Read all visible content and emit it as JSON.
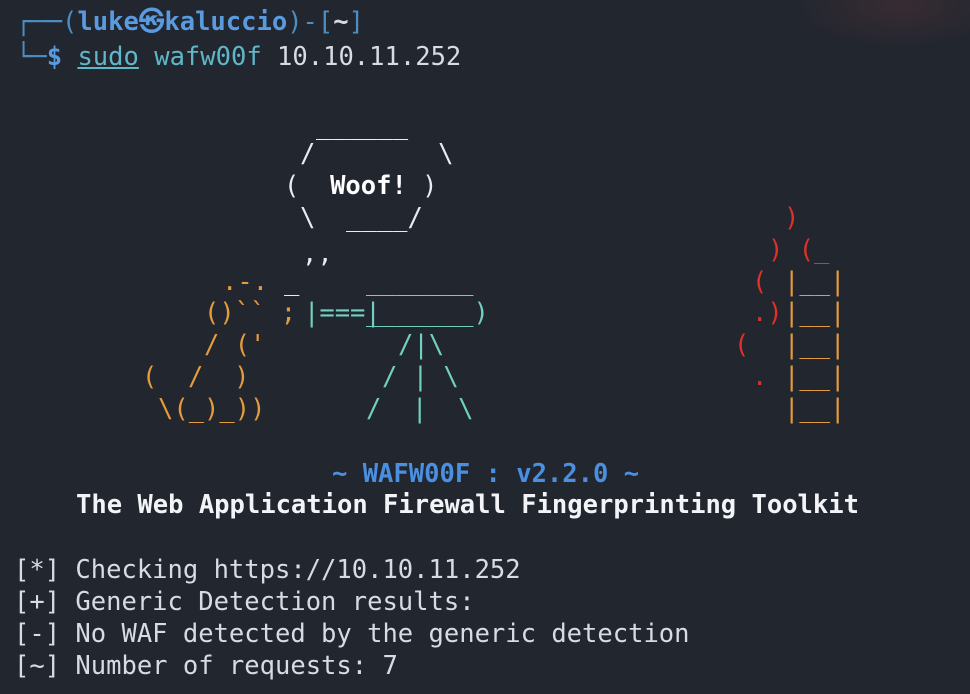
{
  "prompt": {
    "frame_top": "┌──(",
    "user": "luke",
    "at_symbol": "㉿",
    "host": "kaluccio",
    "frame_mid": ")-[",
    "cwd": "~",
    "frame_end": "]",
    "frame_bottom": "└─",
    "dollar": "$",
    "cmd_sudo": "sudo",
    "cmd_main": "wafw00f",
    "cmd_arg": "10.10.11.252"
  },
  "ascii_art": {
    "bubble_top": "______",
    "bubble_l2": "/        \\",
    "bubble_l3_open": "(  ",
    "bubble_text": "Woof!",
    "bubble_l3_close": " )",
    "bubble_l4": "\\  ____/",
    "bubble_tail": ",,",
    "dog_l1": ".-.",
    "dog_tick": "_",
    "dog_l2a": "()",
    "dog_l2b": "``",
    "dog_l2c": ";",
    "dog_l3": "/ ('",
    "dog_l4": "(  /  )",
    "dog_l5": "\\(_)_))",
    "gun_handle": "|===|",
    "gun_top": "_______",
    "gun_body": "_______)",
    "tripod_1": "/|\\",
    "tripod_2": "/ | \\",
    "tripod_3": "/  |  \\",
    "fire_1": ")",
    "fire_2": ") (_",
    "fire_3": "(",
    "fire_4": ".)",
    "fire_5": "(",
    "fire_6": ".",
    "wall_row": "|__|"
  },
  "banner": {
    "version": "~ WAFW00F : v2.2.0 ~",
    "title": "The Web Application Firewall Fingerprinting Toolkit"
  },
  "output": [
    "[*] Checking https://10.10.11.252",
    "[+] Generic Detection results:",
    "[-] No WAF detected by the generic detection",
    "[~] Number of requests: 7"
  ],
  "colors": {
    "background": "#22262f",
    "prompt_blue": "#5a9be0",
    "command_cyan": "#5fb7c8",
    "dog_orange": "#e59a3c",
    "gun_teal": "#72d0c0",
    "fire_red": "#e0302a",
    "version_blue": "#4a8fe0"
  }
}
